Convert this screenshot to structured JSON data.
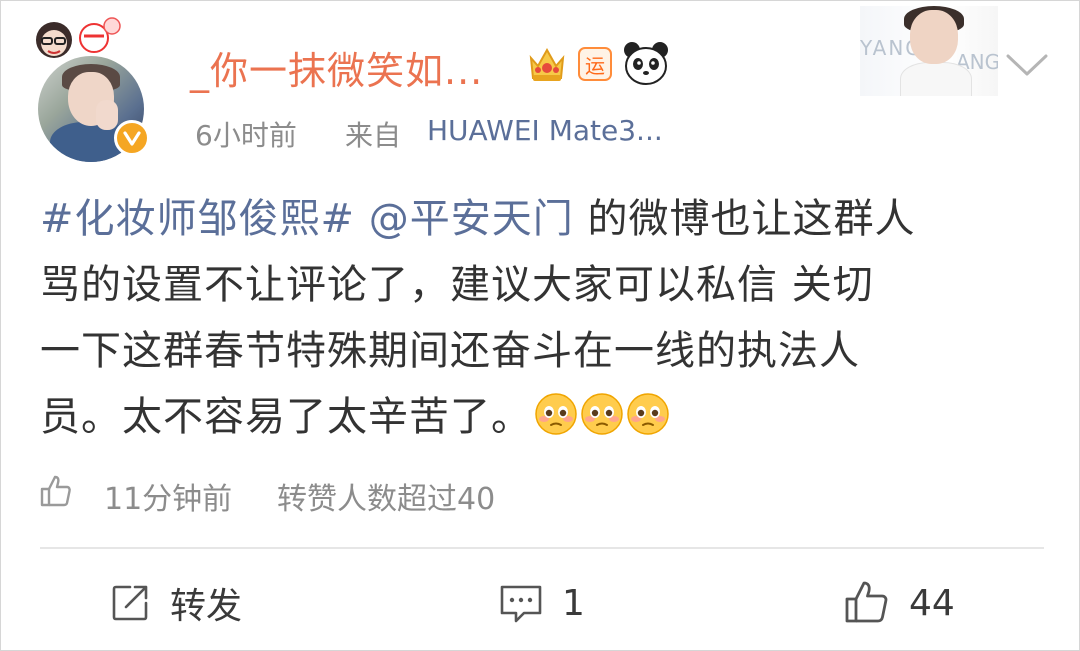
{
  "post": {
    "username": "_你一抹微笑如...",
    "yun_badge": "运",
    "time": "6小时前",
    "source_prefix": "来自",
    "source_device": "HUAWEI Mate3...",
    "card_background_text": "YANG",
    "card_background_text2": "ANG",
    "text_lines": [
      {
        "hashtag": "#化妆师邹俊熙#",
        "mention": "@平安天门",
        "rest": " 的微博也让这群人"
      },
      {
        "text": "骂的设置不让评论了，建议大家可以私信 关切"
      },
      {
        "text": "一下这群春节特殊期间还奋斗在一线的执法人"
      },
      {
        "text": "员。太不容易了太辛苦了。"
      }
    ],
    "emoji_count": 3,
    "meta_time": "11分钟前",
    "meta_stat": "转赞人数超过40"
  },
  "actions": {
    "repost_label": "转发",
    "comment_count": "1",
    "like_count": "44"
  },
  "colors": {
    "username": "#eb7350",
    "link": "#5b6f99",
    "text": "#333333",
    "meta": "#8c8c8c",
    "verified": "#f5a623"
  },
  "icons": [
    "avatar-pendant",
    "verified-icon",
    "crown-icon",
    "panda-icon",
    "chevron-down-icon",
    "thumbs-up-icon",
    "repost-icon",
    "comment-icon",
    "like-icon",
    "pleading-face-emoji"
  ]
}
